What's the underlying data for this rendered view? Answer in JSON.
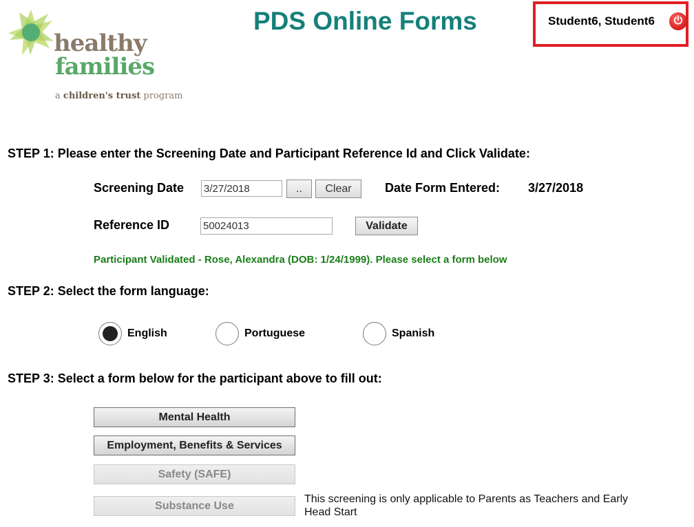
{
  "header": {
    "logo": {
      "line1": "healthy",
      "line2": "families",
      "trademark": "tm",
      "tagline_prefix": "a",
      "tagline_bold": "children's trust",
      "tagline_suffix": "program"
    },
    "title": "PDS Online Forms",
    "user": {
      "name": "Student6, Student6",
      "logout_icon": "power-icon"
    },
    "colors": {
      "title": "#15807a",
      "user_box_border": "#e01e26",
      "validated_text": "#1a7d1a"
    }
  },
  "step1": {
    "heading": "STEP 1: Please enter the Screening Date and Participant Reference Id and Click Validate:",
    "screening_date_label": "Screening Date",
    "screening_date_value": "3/27/2018",
    "date_picker_label": "..",
    "clear_label": "Clear",
    "date_entered_label": "Date Form Entered:",
    "date_entered_value": "3/27/2018",
    "reference_id_label": "Reference ID",
    "reference_id_value": "50024013",
    "validate_label": "Validate",
    "validation_message": "Participant Validated - Rose, Alexandra (DOB: 1/24/1999). Please select a form below"
  },
  "step2": {
    "heading": "STEP 2: Select the form language:",
    "options": [
      {
        "label": "English",
        "selected": true
      },
      {
        "label": "Portuguese",
        "selected": false
      },
      {
        "label": "Spanish",
        "selected": false
      }
    ]
  },
  "step3": {
    "heading": "STEP 3: Select a form below for the participant above to fill out:",
    "forms": [
      {
        "label": "Mental Health",
        "enabled": true
      },
      {
        "label": "Employment, Benefits & Services",
        "enabled": true
      },
      {
        "label": "Safety (SAFE)",
        "enabled": false
      },
      {
        "label": "Substance Use",
        "enabled": false
      }
    ],
    "substance_note": "This screening is only applicable to Parents as Teachers and Early Head Start"
  }
}
